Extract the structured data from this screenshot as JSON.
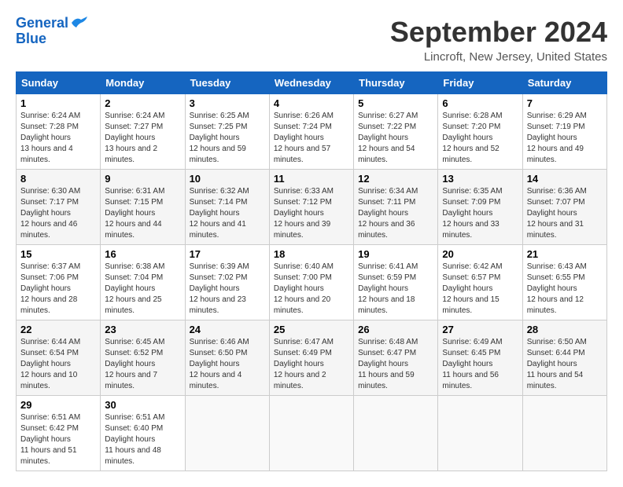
{
  "header": {
    "logo_line1": "General",
    "logo_line2": "Blue",
    "month": "September 2024",
    "location": "Lincroft, New Jersey, United States"
  },
  "days_of_week": [
    "Sunday",
    "Monday",
    "Tuesday",
    "Wednesday",
    "Thursday",
    "Friday",
    "Saturday"
  ],
  "weeks": [
    [
      {
        "day": "1",
        "sunrise": "6:24 AM",
        "sunset": "7:28 PM",
        "daylight": "13 hours and 4 minutes."
      },
      {
        "day": "2",
        "sunrise": "6:24 AM",
        "sunset": "7:27 PM",
        "daylight": "13 hours and 2 minutes."
      },
      {
        "day": "3",
        "sunrise": "6:25 AM",
        "sunset": "7:25 PM",
        "daylight": "12 hours and 59 minutes."
      },
      {
        "day": "4",
        "sunrise": "6:26 AM",
        "sunset": "7:24 PM",
        "daylight": "12 hours and 57 minutes."
      },
      {
        "day": "5",
        "sunrise": "6:27 AM",
        "sunset": "7:22 PM",
        "daylight": "12 hours and 54 minutes."
      },
      {
        "day": "6",
        "sunrise": "6:28 AM",
        "sunset": "7:20 PM",
        "daylight": "12 hours and 52 minutes."
      },
      {
        "day": "7",
        "sunrise": "6:29 AM",
        "sunset": "7:19 PM",
        "daylight": "12 hours and 49 minutes."
      }
    ],
    [
      {
        "day": "8",
        "sunrise": "6:30 AM",
        "sunset": "7:17 PM",
        "daylight": "12 hours and 46 minutes."
      },
      {
        "day": "9",
        "sunrise": "6:31 AM",
        "sunset": "7:15 PM",
        "daylight": "12 hours and 44 minutes."
      },
      {
        "day": "10",
        "sunrise": "6:32 AM",
        "sunset": "7:14 PM",
        "daylight": "12 hours and 41 minutes."
      },
      {
        "day": "11",
        "sunrise": "6:33 AM",
        "sunset": "7:12 PM",
        "daylight": "12 hours and 39 minutes."
      },
      {
        "day": "12",
        "sunrise": "6:34 AM",
        "sunset": "7:11 PM",
        "daylight": "12 hours and 36 minutes."
      },
      {
        "day": "13",
        "sunrise": "6:35 AM",
        "sunset": "7:09 PM",
        "daylight": "12 hours and 33 minutes."
      },
      {
        "day": "14",
        "sunrise": "6:36 AM",
        "sunset": "7:07 PM",
        "daylight": "12 hours and 31 minutes."
      }
    ],
    [
      {
        "day": "15",
        "sunrise": "6:37 AM",
        "sunset": "7:06 PM",
        "daylight": "12 hours and 28 minutes."
      },
      {
        "day": "16",
        "sunrise": "6:38 AM",
        "sunset": "7:04 PM",
        "daylight": "12 hours and 25 minutes."
      },
      {
        "day": "17",
        "sunrise": "6:39 AM",
        "sunset": "7:02 PM",
        "daylight": "12 hours and 23 minutes."
      },
      {
        "day": "18",
        "sunrise": "6:40 AM",
        "sunset": "7:00 PM",
        "daylight": "12 hours and 20 minutes."
      },
      {
        "day": "19",
        "sunrise": "6:41 AM",
        "sunset": "6:59 PM",
        "daylight": "12 hours and 18 minutes."
      },
      {
        "day": "20",
        "sunrise": "6:42 AM",
        "sunset": "6:57 PM",
        "daylight": "12 hours and 15 minutes."
      },
      {
        "day": "21",
        "sunrise": "6:43 AM",
        "sunset": "6:55 PM",
        "daylight": "12 hours and 12 minutes."
      }
    ],
    [
      {
        "day": "22",
        "sunrise": "6:44 AM",
        "sunset": "6:54 PM",
        "daylight": "12 hours and 10 minutes."
      },
      {
        "day": "23",
        "sunrise": "6:45 AM",
        "sunset": "6:52 PM",
        "daylight": "12 hours and 7 minutes."
      },
      {
        "day": "24",
        "sunrise": "6:46 AM",
        "sunset": "6:50 PM",
        "daylight": "12 hours and 4 minutes."
      },
      {
        "day": "25",
        "sunrise": "6:47 AM",
        "sunset": "6:49 PM",
        "daylight": "12 hours and 2 minutes."
      },
      {
        "day": "26",
        "sunrise": "6:48 AM",
        "sunset": "6:47 PM",
        "daylight": "11 hours and 59 minutes."
      },
      {
        "day": "27",
        "sunrise": "6:49 AM",
        "sunset": "6:45 PM",
        "daylight": "11 hours and 56 minutes."
      },
      {
        "day": "28",
        "sunrise": "6:50 AM",
        "sunset": "6:44 PM",
        "daylight": "11 hours and 54 minutes."
      }
    ],
    [
      {
        "day": "29",
        "sunrise": "6:51 AM",
        "sunset": "6:42 PM",
        "daylight": "11 hours and 51 minutes."
      },
      {
        "day": "30",
        "sunrise": "6:51 AM",
        "sunset": "6:40 PM",
        "daylight": "11 hours and 48 minutes."
      },
      null,
      null,
      null,
      null,
      null
    ]
  ],
  "labels": {
    "sunrise": "Sunrise:",
    "sunset": "Sunset:",
    "daylight": "Daylight hours"
  }
}
